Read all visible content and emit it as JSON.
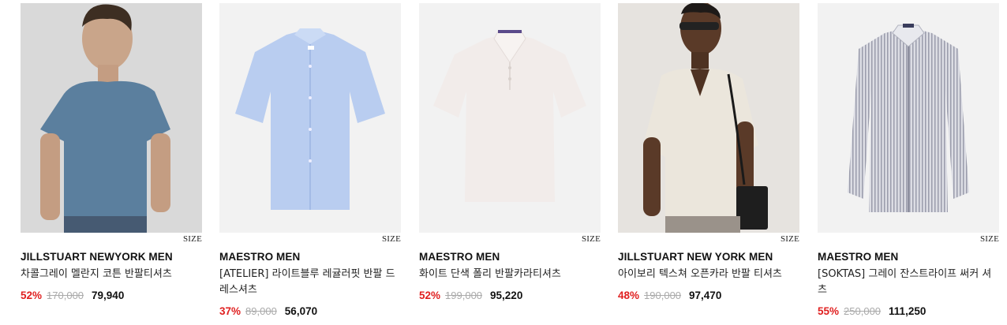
{
  "size_label": "SIZE",
  "products": [
    {
      "brand": "JILLSTUART NEWYORK MEN",
      "name": "차콜그레이 멜란지 코튼 반팔티셔츠",
      "discount": "52%",
      "original_price": "170,000",
      "final_price": "79,940"
    },
    {
      "brand": "MAESTRO MEN",
      "name": "[ATELIER] 라이트블루 레귤러핏 반팔 드레스셔츠",
      "discount": "37%",
      "original_price": "89,000",
      "final_price": "56,070"
    },
    {
      "brand": "MAESTRO MEN",
      "name": "화이트 단색 폴리 반팔카라티셔츠",
      "discount": "52%",
      "original_price": "199,000",
      "final_price": "95,220"
    },
    {
      "brand": "JILLSTUART NEW YORK MEN",
      "name": "아이보리 텍스쳐 오픈카라 반팔 티셔츠",
      "discount": "48%",
      "original_price": "190,000",
      "final_price": "97,470"
    },
    {
      "brand": "MAESTRO MEN",
      "name": "[SOKTAS] 그레이 잔스트라이프 써커 셔츠",
      "discount": "55%",
      "original_price": "250,000",
      "final_price": "111,250"
    }
  ],
  "colors": {
    "discount": "#e02020",
    "strike": "#aaaaaa",
    "text": "#111111"
  }
}
